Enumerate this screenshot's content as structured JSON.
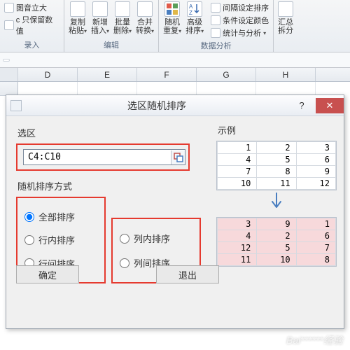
{
  "ribbon": {
    "left_small": [
      "图音立大",
      "c 只保留数值"
    ],
    "left_footer": "录入",
    "items": [
      {
        "l1": "复制",
        "l2": "粘贴"
      },
      {
        "l1": "新增",
        "l2": "插入"
      },
      {
        "l1": "批量",
        "l2": "删除"
      },
      {
        "l1": "合并",
        "l2": "转换"
      }
    ],
    "group1_name": "编辑",
    "items2": [
      {
        "l1": "随机",
        "l2": "重复"
      },
      {
        "l1": "高级",
        "l2": "排序"
      }
    ],
    "right_small": [
      "间隔设定排序",
      "条件设定颜色",
      "统计与分析"
    ],
    "group2_name": "数据分析",
    "items3": [
      {
        "l1": "汇总",
        "l2": "拆分"
      }
    ]
  },
  "fx_name": "",
  "cols": [
    "D",
    "E",
    "F",
    "G",
    "H"
  ],
  "dialog": {
    "title": "选区随机排序",
    "sel_label": "选区",
    "sel_value": "C4:C10",
    "mode_label": "随机排序方式",
    "radios_left": [
      "全部排序",
      "行内排序",
      "行间排序"
    ],
    "radios_right": [
      "列内排序",
      "列间排序"
    ],
    "example_label": "示例",
    "ok": "确定",
    "cancel": "退出"
  },
  "example_before": [
    [
      1,
      2,
      3
    ],
    [
      4,
      5,
      6
    ],
    [
      7,
      8,
      9
    ],
    [
      10,
      11,
      12
    ]
  ],
  "example_after": [
    [
      3,
      9,
      1
    ],
    [
      4,
      2,
      6
    ],
    [
      12,
      5,
      7
    ],
    [
      11,
      10,
      8
    ]
  ],
  "watermark": "Bai******经验"
}
